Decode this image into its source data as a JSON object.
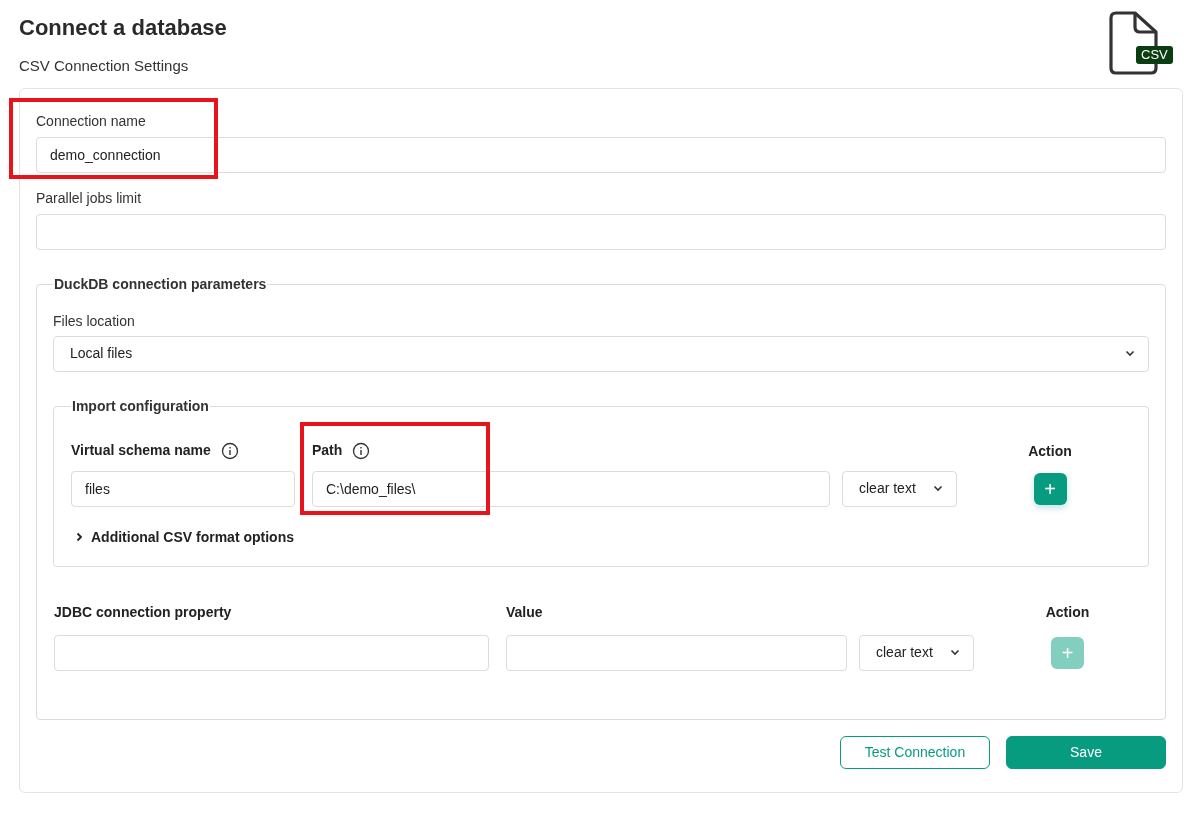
{
  "page": {
    "title": "Connect a database",
    "subtitle": "CSV Connection Settings",
    "file_badge": "CSV"
  },
  "fields": [
    {
      "label": "Connection name",
      "value": "demo_connection",
      "highlighted": true
    },
    {
      "label": "Parallel jobs limit",
      "highlighted": false
    }
  ],
  "duckdb": {
    "legend": "DuckDB connection parameters",
    "files_location": {
      "label": "Files location",
      "value": "Local files"
    },
    "import": {
      "legend": "Import configuration",
      "schema": {
        "label": "Virtual schema name",
        "value": "files",
        "highlighted": false
      },
      "path": {
        "label": "Path",
        "value": "C:\\demo_files\\",
        "highlighted": true
      },
      "mode": "clear text",
      "action": {
        "label": "Action",
        "button": "+",
        "disabled": false
      },
      "options": {
        "label": "Additional CSV format options",
        "expanded": false
      }
    },
    "jdbc": {
      "property_label": "JDBC connection property",
      "value_label": "Value",
      "mode": "clear text",
      "action": {
        "label": "Action",
        "button": "+",
        "disabled": true
      }
    }
  },
  "buttons": [
    {
      "label": "Test Connection",
      "kind": "outline"
    },
    {
      "label": "Save",
      "kind": "primary"
    }
  ]
}
